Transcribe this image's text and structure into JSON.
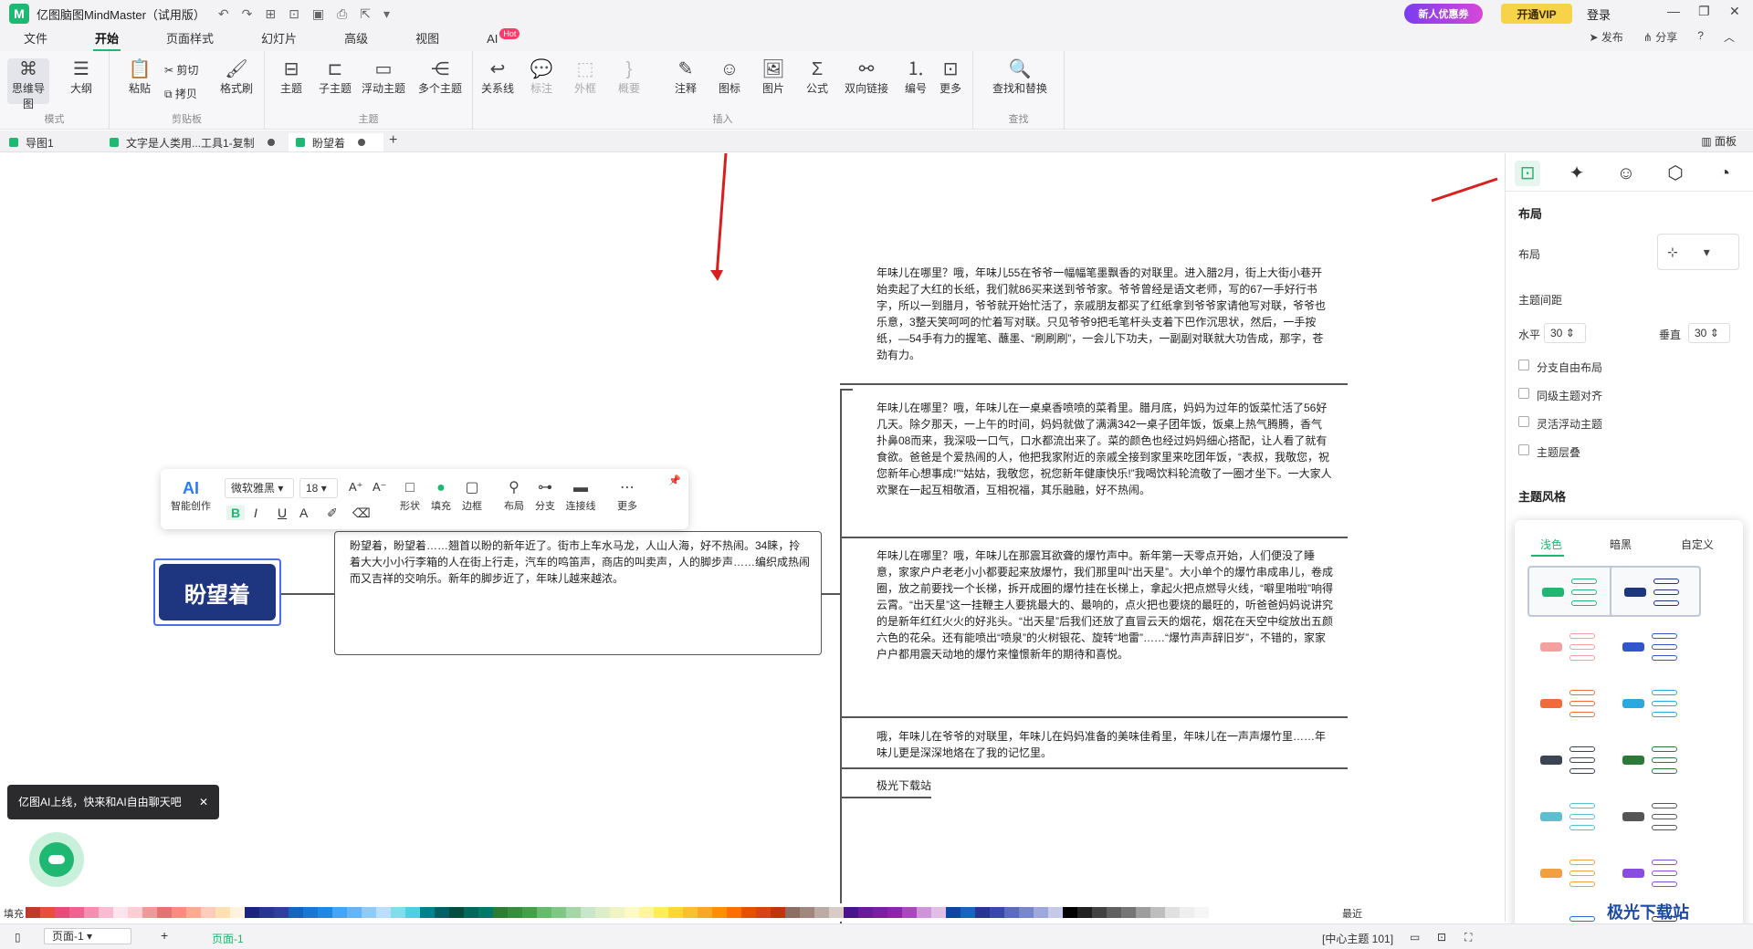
{
  "app": {
    "title": "亿图脑图MindMaster（试用版）",
    "logo_text": "M",
    "promo": "新人优惠券",
    "vip": "开通VIP",
    "login": "登录"
  },
  "menu": {
    "tabs": [
      "文件",
      "开始",
      "页面样式",
      "幻灯片",
      "高级",
      "视图",
      "AI"
    ],
    "active": "开始",
    "hot": "Hot",
    "right": [
      "发布",
      "分享",
      "?"
    ]
  },
  "ribbon": {
    "mode": {
      "label": "模式",
      "items": [
        "思维导图",
        "大纲"
      ]
    },
    "clipboard": {
      "label": "剪贴板",
      "paste": "粘贴",
      "cut": "剪切",
      "copy": "拷贝",
      "format_painter": "格式刷"
    },
    "topic": {
      "label": "主题",
      "items": [
        "主题",
        "子主题",
        "浮动主题",
        "多个主题"
      ]
    },
    "insert": {
      "label": "插入",
      "items": [
        "关系线",
        "标注",
        "外框",
        "概要",
        "注释",
        "图标",
        "图片",
        "公式",
        "双向链接",
        "编号",
        "更多"
      ]
    },
    "find": {
      "label": "查找",
      "item": "查找和替换"
    }
  },
  "doc_tabs": [
    "导图1",
    "文字是人类用...工具1-复制",
    "盼望着"
  ],
  "panel_toggle": "面板",
  "map": {
    "central": "盼望着",
    "main_topic": "盼望着，盼望着……翘首以盼的新年近了。街市上车水马龙，人山人海，好不热闹。34睐，拎着大大小小行李箱的人在街上行走，汽车的鸣笛声，商店的叫卖声，人的脚步声……编织成热闹而又吉祥的交响乐。新年的脚步近了，年味儿越来越浓。",
    "sub_topics": [
      "年味儿在哪里？哦，年味儿55在爷爷一幅幅笔墨飘香的对联里。进入腊2月，街上大街小巷开始卖起了大红的长纸，我们就86买来送到爷爷家。爷爷曾经是语文老师，写的67一手好行书字，所以一到腊月，爷爷就开始忙活了，亲戚朋友都买了红纸拿到爷爷家请他写对联，爷爷也乐意，3整天笑呵呵的忙着写对联。只见爷爷9把毛笔杆头支着下巴作沉思状，然后，一手按纸，—54手有力的握笔、蘸墨、“刷刷刷”，一会儿下功夫，一副副对联就大功告成，那字，苍劲有力。",
      "年味儿在哪里？哦，年味儿在一桌桌香喷喷的菜肴里。腊月底，妈妈为过年的饭菜忙活了56好几天。除夕那天，一上午的时间，妈妈就做了满满342一桌子团年饭，饭桌上热气腾腾，香气扑鼻08而来，我深吸一口气，口水都流出来了。菜的颜色也经过妈妈细心搭配，让人看了就有食欲。爸爸是个爱热闹的人，他把我家附近的亲戚全接到家里来吃团年饭，“表叔，我敬您，祝您新年心想事成!”“姑姑，我敬您，祝您新年健康快乐!”我喝饮料轮流敬了一圈才坐下。一大家人欢聚在一起互相敬酒，互相祝福，其乐融融，好不热闹。",
      "年味儿在哪里？哦，年味儿在那震耳欲聋的爆竹声中。新年第一天零点开始，人们便没了睡意，家家户户老老小小都要起来放爆竹，我们那里叫“出天星”。大小单个的爆竹串成串儿，卷成圈，放之前要找一个长梯，拆开成圈的爆竹挂在长梯上，拿起火把点燃导火线，“噼里啪啦”响得云霄。“出天星”这一挂鞭主人要挑最大的、最响的，点火把也要烧的最旺的，听爸爸妈妈说讲究的是新年红红火火的好兆头。“出天星”后我们还放了直冒云天的烟花，烟花在天空中绽放出五颜六色的花朵。还有能喷出“喷泉”的火树银花、旋转“地雷”……“爆竹声声辞旧岁”，不错的，家家户户都用震天动地的爆竹来憧憬新年的期待和喜悦。",
      "哦，年味儿在爷爷的对联里，年味儿在妈妈准备的美味佳肴里，年味儿在一声声爆竹里……年味儿更是深深地烙在了我的记忆里。",
      "极光下载站"
    ]
  },
  "float_toolbar": {
    "ai": "AI",
    "ai_label": "智能创作",
    "font": "微软雅黑",
    "size": "18",
    "bold": "B",
    "italic": "I",
    "underline": "U",
    "font_color": "A",
    "shape": "形状",
    "fill": "填充",
    "border": "边框",
    "layout": "布局",
    "branch": "分支",
    "line": "连接线",
    "more": "更多"
  },
  "right_panel": {
    "section_layout": "布局",
    "layout_label": "布局",
    "spacing_label": "主题间距",
    "h_label": "水平",
    "h_value": "30",
    "v_label": "垂直",
    "v_value": "30",
    "checks": [
      "分支自由布局",
      "同级主题对齐",
      "灵活浮动主题",
      "主题层叠"
    ],
    "section_style": "主题风格",
    "style_tabs": [
      "浅色",
      "暗黑",
      "自定义"
    ],
    "style_active": "浅色"
  },
  "colors": {
    "accent": "#1fb872",
    "central_fill": "#1e3580",
    "central_border": "#4c6cf0",
    "annotation": "#d81e1e"
  },
  "bottom": {
    "fill_label": "填充",
    "recent_label": "最近",
    "page_select": "页面-1",
    "page_tab": "页面-1",
    "status": "[中心主题 101]"
  },
  "ai_tip": "亿图AI上线，快来和AI自由聊天吧",
  "watermark": "极光下载站"
}
